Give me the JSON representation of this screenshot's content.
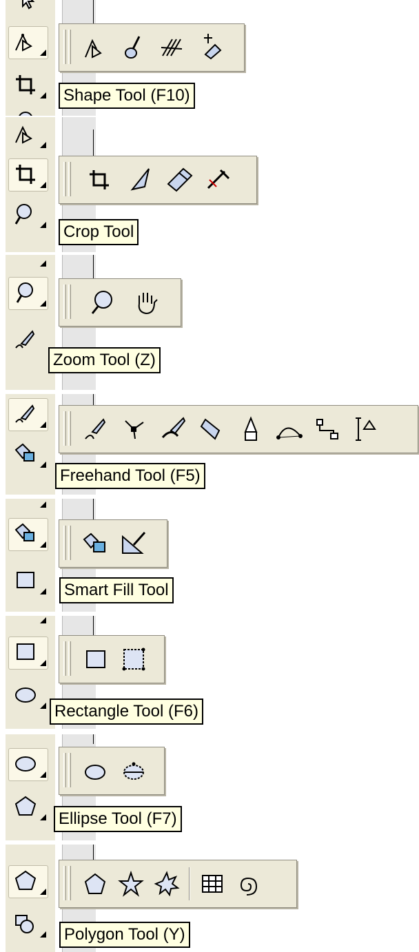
{
  "panels": [
    {
      "tool": "shape",
      "tooltip": "Shape Tool (F10)",
      "flyout_icons": [
        "shape-icon",
        "smudge-brush-icon",
        "roughen-brush-icon",
        "free-transform-icon"
      ]
    },
    {
      "tool": "crop",
      "tooltip": "Crop Tool",
      "flyout_icons": [
        "crop-icon",
        "knife-icon",
        "eraser-icon",
        "virtual-segment-delete-icon"
      ]
    },
    {
      "tool": "zoom",
      "tooltip": "Zoom Tool (Z)",
      "flyout_icons": [
        "zoom-icon",
        "hand-icon"
      ]
    },
    {
      "tool": "freehand",
      "tooltip": "Freehand Tool (F5)",
      "flyout_icons": [
        "freehand-icon",
        "bezier-icon",
        "artistic-media-icon",
        "pen-icon",
        "polyline-icon",
        "three-point-curve-icon",
        "connector-icon",
        "dimension-icon"
      ]
    },
    {
      "tool": "smart-fill",
      "tooltip": "Smart Fill Tool",
      "flyout_icons": [
        "smart-fill-icon",
        "smart-drawing-icon"
      ]
    },
    {
      "tool": "rectangle",
      "tooltip": "Rectangle Tool (F6)",
      "flyout_icons": [
        "rectangle-icon",
        "three-point-rectangle-icon"
      ]
    },
    {
      "tool": "ellipse",
      "tooltip": "Ellipse Tool (F7)",
      "flyout_icons": [
        "ellipse-icon",
        "three-point-ellipse-icon"
      ]
    },
    {
      "tool": "polygon",
      "tooltip": "Polygon Tool (Y)",
      "flyout_icons": [
        "polygon-icon",
        "star-icon",
        "complex-star-icon",
        "graph-paper-icon",
        "spiral-icon"
      ]
    }
  ],
  "colors": {
    "toolbar": "#ece9d8",
    "tooltip_bg": "#ffffe1",
    "border": "#8f8c80",
    "ruler": "#e6e6e6"
  }
}
